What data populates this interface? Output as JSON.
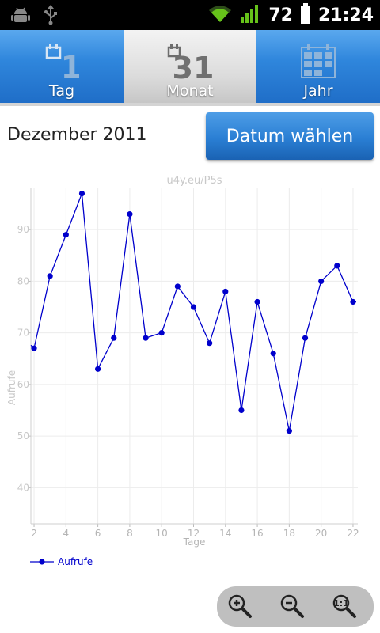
{
  "statusbar": {
    "battery": "72",
    "time": "21:24"
  },
  "tabs": [
    {
      "label": "Tag",
      "icon_number": "1",
      "icon": "calendar-day-icon"
    },
    {
      "label": "Monat",
      "icon_number": "31",
      "icon": "calendar-month-icon"
    },
    {
      "label": "Jahr",
      "icon": "calendar-year-icon"
    }
  ],
  "header": {
    "month": "Dezember 2011",
    "date_button": "Datum wählen"
  },
  "chart_data": {
    "type": "line",
    "title": "u4y.eu/P5s",
    "xlabel": "Tage",
    "ylabel": "Aufrufe",
    "xlim": [
      1.8,
      22.3
    ],
    "ylim": [
      33,
      98
    ],
    "x_ticks": [
      2,
      4,
      6,
      8,
      10,
      12,
      14,
      16,
      18,
      20,
      22
    ],
    "y_ticks": [
      40,
      50,
      60,
      70,
      80,
      90
    ],
    "grid": true,
    "legend": "bottom-left",
    "series": [
      {
        "name": "Aufrufe",
        "color": "#0000cc",
        "x": [
          2,
          3,
          4,
          5,
          6,
          7,
          8,
          9,
          10,
          11,
          12,
          13,
          14,
          15,
          16,
          17,
          18,
          19,
          20,
          21,
          22
        ],
        "values": [
          67,
          81,
          89,
          97,
          63,
          69,
          93,
          69,
          70,
          79,
          75,
          68,
          78,
          55,
          76,
          66,
          51,
          69,
          80,
          83,
          76
        ]
      }
    ]
  },
  "zoom": {
    "zoom_in_icon": "zoom-in-icon",
    "zoom_out_icon": "zoom-out-icon",
    "zoom_reset_icon": "zoom-reset-icon"
  }
}
